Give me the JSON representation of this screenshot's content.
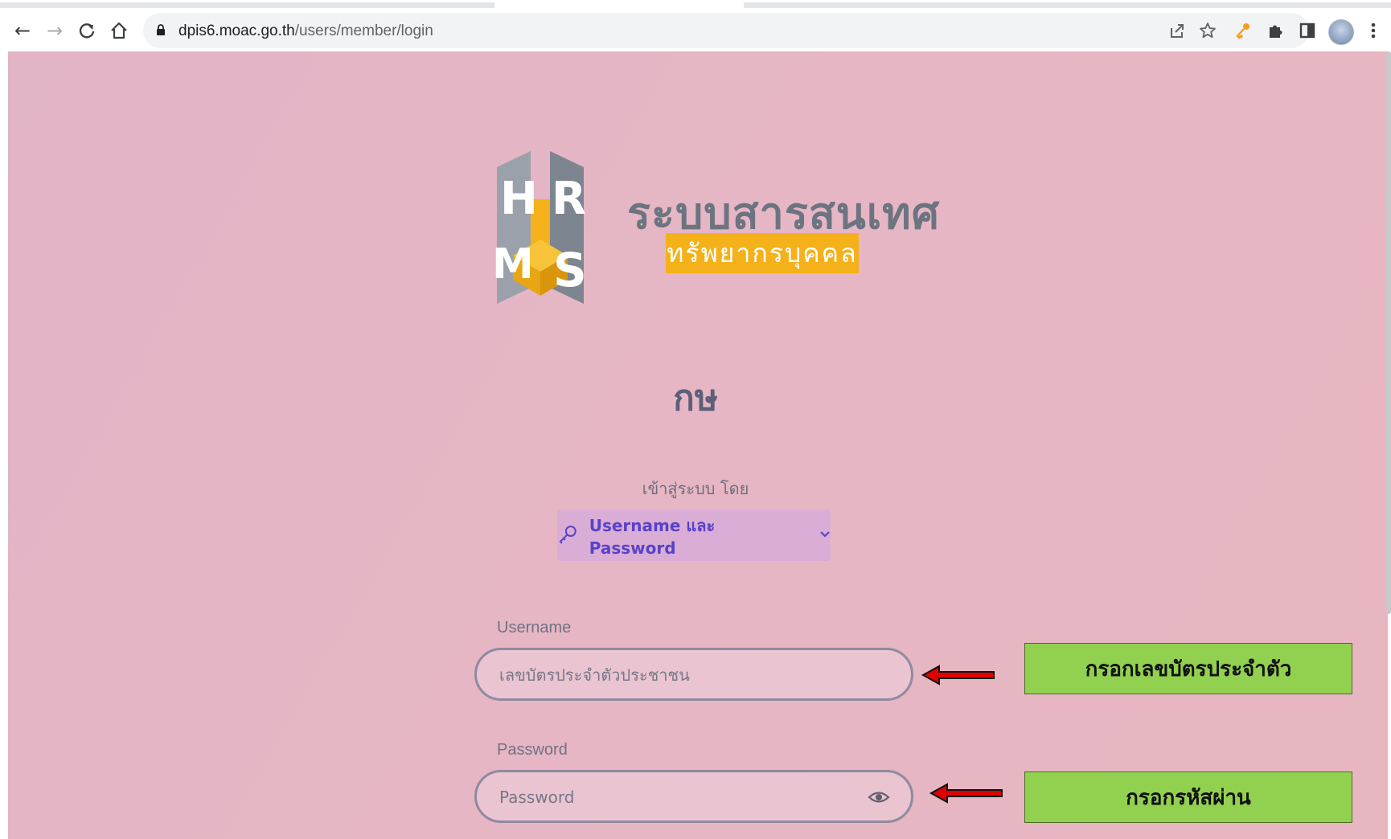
{
  "browser": {
    "url_domain": "dpis6.moac.go.th",
    "url_path": "/users/member/login",
    "nav": {
      "back": "←",
      "forward": "→",
      "reload": "C",
      "home": "⌂"
    },
    "icons": [
      "share-icon",
      "star-icon",
      "key-extension-icon",
      "puzzle-extensions-icon",
      "side-panel-icon",
      "profile-avatar",
      "menu-dots-icon"
    ]
  },
  "logo": {
    "letters": [
      "H",
      "R",
      "M",
      "S"
    ],
    "title": "ระบบสารสนเทศ",
    "subtitle": "ทรัพยากรบุคคล",
    "accent_color": "#f5b11a"
  },
  "org_name": "กษ",
  "login_by_label": "เข้าสู่ระบบ โดย",
  "login_method": {
    "label": "Username และ Password",
    "color": "#5842c8"
  },
  "username": {
    "label": "Username",
    "placeholder": "เลขบัตรประจำตัวประชาชน",
    "value": ""
  },
  "password": {
    "label": "Password",
    "placeholder": "Password",
    "value": ""
  },
  "annotations": {
    "username_note": "กรอกเลขบัตรประจำตัว",
    "password_note": "กรอกรหัสผ่าน",
    "note_color": "#92d050",
    "arrow_color": "#e00000"
  }
}
